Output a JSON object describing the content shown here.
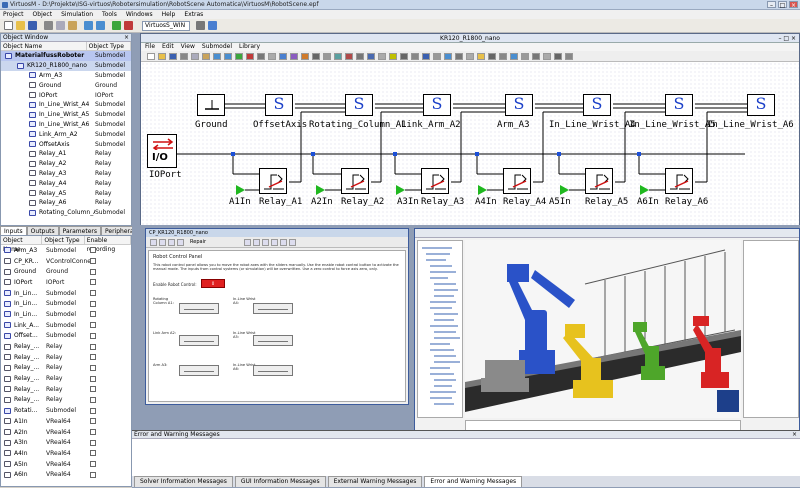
{
  "app": {
    "title": "VirtuosM - D:\\Projekte\\ISG-virtuos\\Robotersimulation\\RobotScene Automatica\\VirtuosM\\RobotScene.epf"
  },
  "menubar": [
    "Project",
    "Object",
    "Simulation",
    "Tools",
    "Windows",
    "Help",
    "Extras"
  ],
  "toolbar": {
    "solver_combo": "VirtuosS_WIN"
  },
  "object_window": {
    "title": "Object Window",
    "columns": [
      "Object Name",
      "Object Type"
    ],
    "rows": [
      {
        "name": "MaterialfussRoboter",
        "type": "Submodel",
        "level": 0
      },
      {
        "name": "KR120_R1800_nano",
        "type": "Submodel",
        "level": 1
      },
      {
        "name": "Arm_A3",
        "type": "Submodel",
        "level": 2
      },
      {
        "name": "Ground",
        "type": "Ground",
        "level": 2
      },
      {
        "name": "IOPort",
        "type": "IOPort",
        "level": 2
      },
      {
        "name": "In_Line_Wrist_A4",
        "type": "Submodel",
        "level": 2
      },
      {
        "name": "In_Line_Wrist_A5",
        "type": "Submodel",
        "level": 2
      },
      {
        "name": "In_Line_Wrist_A6",
        "type": "Submodel",
        "level": 2
      },
      {
        "name": "Link_Arm_A2",
        "type": "Submodel",
        "level": 2
      },
      {
        "name": "OffsetAxis",
        "type": "Submodel",
        "level": 2
      },
      {
        "name": "Relay_A1",
        "type": "Relay",
        "level": 2
      },
      {
        "name": "Relay_A2",
        "type": "Relay",
        "level": 2
      },
      {
        "name": "Relay_A3",
        "type": "Relay",
        "level": 2
      },
      {
        "name": "Relay_A4",
        "type": "Relay",
        "level": 2
      },
      {
        "name": "Relay_A5",
        "type": "Relay",
        "level": 2
      },
      {
        "name": "Relay_A6",
        "type": "Relay",
        "level": 2
      },
      {
        "name": "Rotating_Column_A1",
        "type": "Submodel",
        "level": 2
      }
    ]
  },
  "io_tabs": [
    "Inputs",
    "Outputs",
    "Parameters",
    "Peripheral IOs"
  ],
  "io_panel": {
    "columns": [
      "Object Name",
      "Object Type",
      "Enable recording"
    ],
    "rows": [
      {
        "name": "Arm_A3",
        "type": "Submodel"
      },
      {
        "name": "CP_KR...",
        "type": "VControlConne..."
      },
      {
        "name": "Ground",
        "type": "Ground"
      },
      {
        "name": "IOPort",
        "type": "IOPort"
      },
      {
        "name": "In_Lin...",
        "type": "Submodel"
      },
      {
        "name": "In_Lin...",
        "type": "Submodel"
      },
      {
        "name": "In_Lin...",
        "type": "Submodel"
      },
      {
        "name": "Link_A...",
        "type": "Submodel"
      },
      {
        "name": "Offset...",
        "type": "Submodel"
      },
      {
        "name": "Relay_...",
        "type": "Relay"
      },
      {
        "name": "Relay_...",
        "type": "Relay"
      },
      {
        "name": "Relay_...",
        "type": "Relay"
      },
      {
        "name": "Relay_...",
        "type": "Relay"
      },
      {
        "name": "Relay_...",
        "type": "Relay"
      },
      {
        "name": "Relay_...",
        "type": "Relay"
      },
      {
        "name": "Rotati...",
        "type": "Submodel"
      },
      {
        "name": "A1In",
        "type": "VReal64"
      },
      {
        "name": "A2In",
        "type": "VReal64"
      },
      {
        "name": "A3In",
        "type": "VReal64"
      },
      {
        "name": "A4In",
        "type": "VReal64"
      },
      {
        "name": "A5In",
        "type": "VReal64"
      },
      {
        "name": "A6In",
        "type": "VReal64"
      }
    ]
  },
  "diagram_window": {
    "title": "KR120_R1800_nano",
    "menu": [
      "File",
      "Edit",
      "View",
      "Submodel",
      "Library"
    ],
    "ground_label": "Ground",
    "io_block": "I/O",
    "io_label": "IOPort",
    "submodels": [
      "OffsetAxis",
      "Rotating_Column_A1",
      "Link_Arm_A2",
      "Arm_A3",
      "In_Line_Wrist_A4",
      "In_Line_Wrist_A5",
      "In_Line_Wrist_A6"
    ],
    "submodel_symbol": "S",
    "inputs": [
      "A1In",
      "A2In",
      "A3In",
      "A4In",
      "A5In",
      "A6In"
    ],
    "relays": [
      "Relay_A1",
      "Relay_A2",
      "Relay_A3",
      "Relay_A4",
      "Relay_A5",
      "Relay_A6"
    ]
  },
  "control_panel": {
    "title": "CP_KR120_R1800_nano",
    "toolbar_label": "Repair",
    "heading": "Robot Control Panel",
    "description": "This robot control panel allows you to move the robot axes with the sliders manually. Use the enable robot control button to activate the manual mode. The inputs from control systems (or simulation) will be overwritten. Use a zero control to force axis zero, only.",
    "enable_label": "Enable Robot Control:",
    "enable_value": "0",
    "controls": [
      {
        "left": "Rotating Column A1:",
        "right": "In-Line Wrist A4:"
      },
      {
        "left": "Link Arm A2:",
        "right": "In-Line Wrist A5:"
      },
      {
        "left": "Arm A3:",
        "right": "In-Line Wrist A6:"
      }
    ]
  },
  "error_window": {
    "title": "Error and Warning Messages"
  },
  "bottom_tabs": [
    "Solver Information Messages",
    "GUI Information Messages",
    "External Warning Messages",
    "Error and Warning Messages"
  ],
  "colors": {
    "submodel_s": "#1a3fc8",
    "input_arrow": "#1fb81f",
    "ioport_red": "#d01010",
    "junction": "#1b4fd8",
    "selection": "#cbd7ee"
  }
}
